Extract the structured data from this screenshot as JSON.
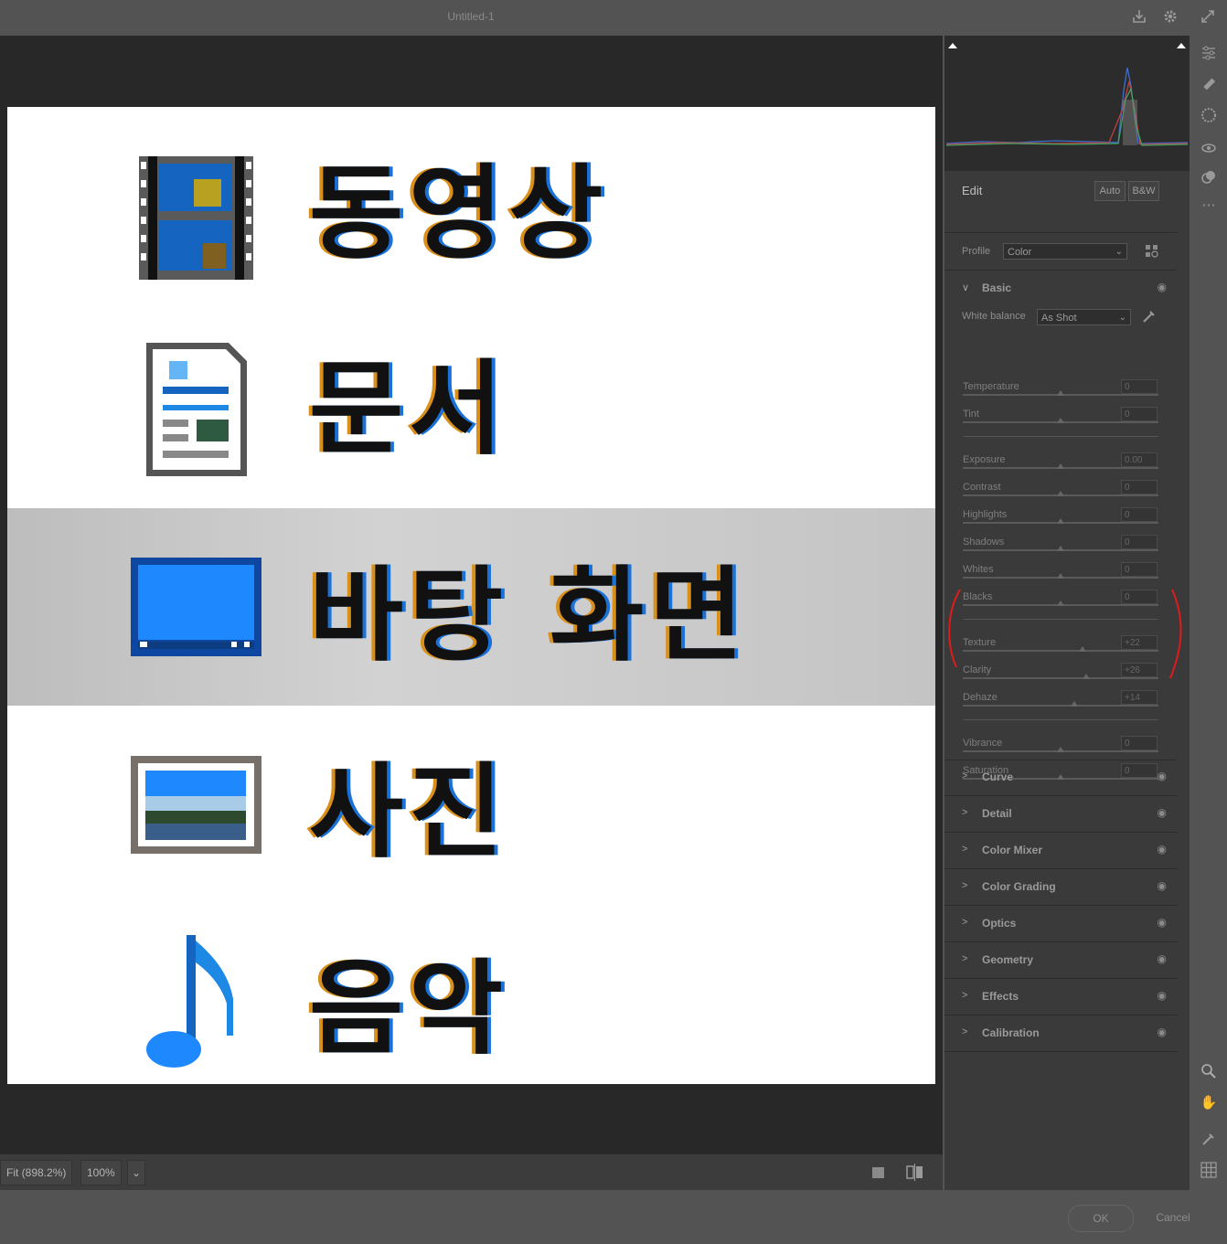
{
  "window": {
    "title": "Untitled-1"
  },
  "image_rows": [
    {
      "label": "동영상",
      "icon": "film-icon"
    },
    {
      "label": "문서",
      "icon": "document-icon"
    },
    {
      "label": "바탕 화면",
      "icon": "desktop-icon"
    },
    {
      "label": "사진",
      "icon": "picture-icon"
    },
    {
      "label": "음악",
      "icon": "music-note-icon"
    }
  ],
  "footer": {
    "fit_label": "Fit (898.2%)",
    "zoom_label": "100%"
  },
  "edit": {
    "title": "Edit",
    "auto_label": "Auto",
    "bw_label": "B&W",
    "profile_label": "Profile",
    "profile_value": "Color"
  },
  "basic": {
    "title": "Basic",
    "wb_label": "White balance",
    "wb_value": "As Shot",
    "sliders": [
      {
        "label": "Temperature",
        "value": "0",
        "pos": 0.5
      },
      {
        "label": "Tint",
        "value": "0",
        "pos": 0.5
      },
      {
        "label": "Exposure",
        "value": "0.00",
        "pos": 0.5
      },
      {
        "label": "Contrast",
        "value": "0",
        "pos": 0.5
      },
      {
        "label": "Highlights",
        "value": "0",
        "pos": 0.5
      },
      {
        "label": "Shadows",
        "value": "0",
        "pos": 0.5
      },
      {
        "label": "Whites",
        "value": "0",
        "pos": 0.5
      },
      {
        "label": "Blacks",
        "value": "0",
        "pos": 0.5
      },
      {
        "label": "Texture",
        "value": "+22",
        "pos": 0.61
      },
      {
        "label": "Clarity",
        "value": "+26",
        "pos": 0.63
      },
      {
        "label": "Dehaze",
        "value": "+14",
        "pos": 0.57
      },
      {
        "label": "Vibrance",
        "value": "0",
        "pos": 0.5
      },
      {
        "label": "Saturation",
        "value": "0",
        "pos": 0.5
      }
    ]
  },
  "panels": [
    {
      "label": "Curve"
    },
    {
      "label": "Detail"
    },
    {
      "label": "Color Mixer"
    },
    {
      "label": "Color Grading"
    },
    {
      "label": "Optics"
    },
    {
      "label": "Geometry"
    },
    {
      "label": "Effects"
    },
    {
      "label": "Calibration"
    }
  ],
  "dialog": {
    "ok_label": "OK",
    "cancel_label": "Cancel"
  },
  "colors": {
    "accent_blue": "#1a72d8",
    "annotation_red": "#e01b1b"
  }
}
